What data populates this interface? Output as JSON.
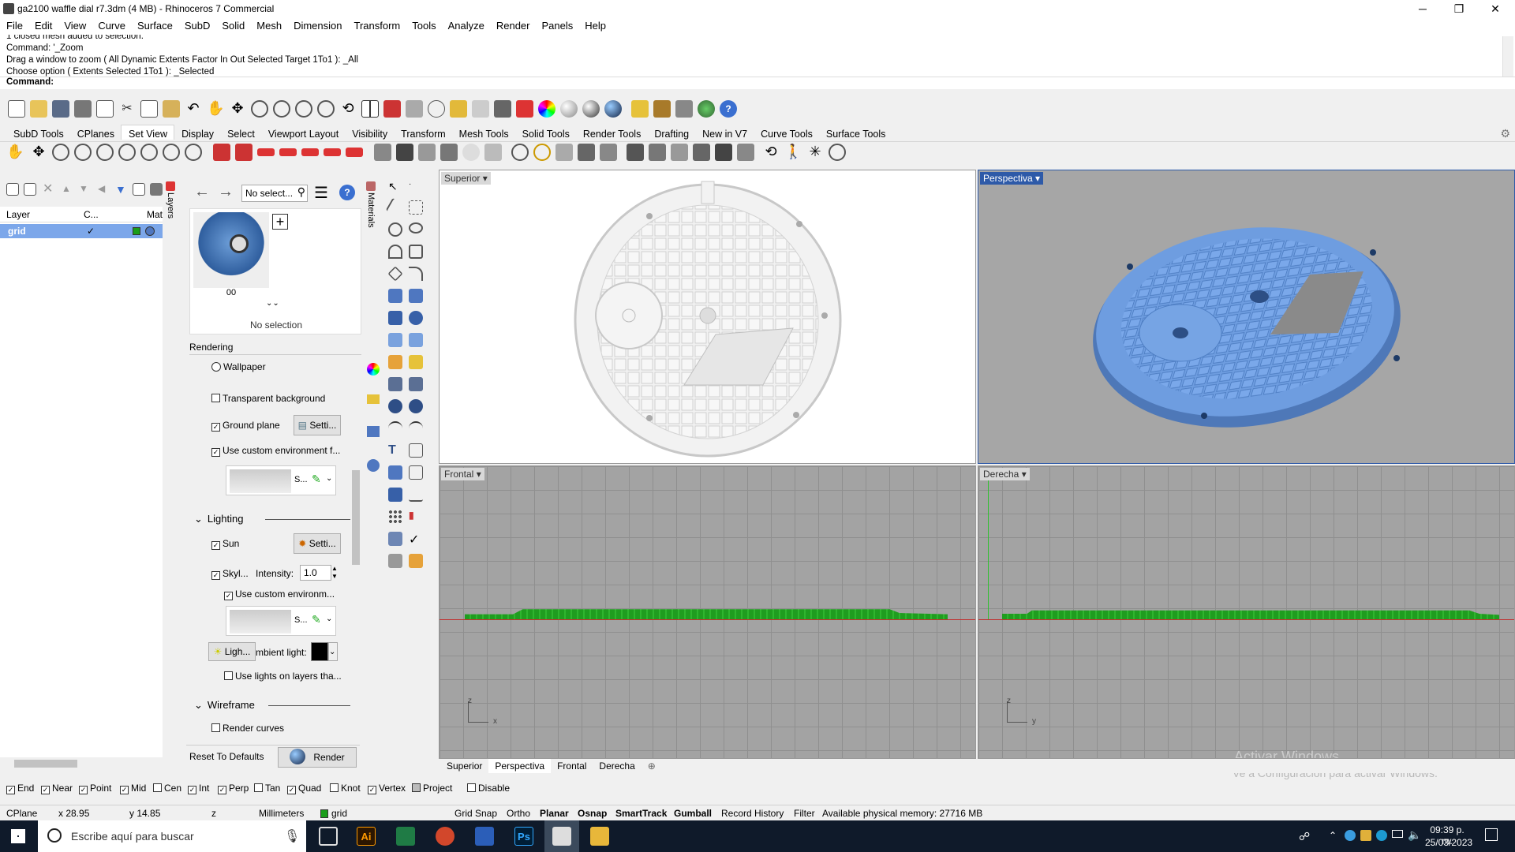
{
  "window": {
    "title": "ga2100 waffle dial r7.3dm (4 MB) - Rhinoceros 7 Commercial",
    "minimize": "─",
    "restore": "❐",
    "close": "✕"
  },
  "menu": [
    "File",
    "Edit",
    "View",
    "Curve",
    "Surface",
    "SubD",
    "Solid",
    "Mesh",
    "Dimension",
    "Transform",
    "Tools",
    "Analyze",
    "Render",
    "Panels",
    "Help"
  ],
  "history": [
    "1 closed mesh added to selection.",
    "Command: '_Zoom",
    "Drag a window to zoom ( All  Dynamic  Extents  Factor  In  Out  Selected  Target  1To1 ): _All",
    "Choose option ( Extents  Selected  1To1 ): _Selected"
  ],
  "command_prompt": "Command:",
  "toolbar_tabs": [
    "SubD Tools",
    "CPlanes",
    "Set View",
    "Display",
    "Select",
    "Viewport Layout",
    "Visibility",
    "Transform",
    "Mesh Tools",
    "Solid Tools",
    "Render Tools",
    "Drafting",
    "New in V7",
    "Curve Tools",
    "Surface Tools"
  ],
  "active_tab": "Set View",
  "layers": {
    "vertical_tab": "Layers",
    "col_layer": "Layer",
    "col_current": "C...",
    "col_material": "Mat",
    "rows": [
      {
        "name": "grid",
        "check": "✓"
      }
    ]
  },
  "materials": {
    "vertical_tab": "Materials",
    "search_placeholder": "No select...",
    "thumb_label": "00",
    "add_symbol": "+",
    "no_selection": "No selection"
  },
  "rendering": {
    "section": "Rendering",
    "wallpaper": "Wallpaper",
    "transparent_bg": "Transparent background",
    "ground_plane": "Ground plane",
    "settings_btn": "Setti...",
    "custom_env": "Use custom environment f...",
    "env_s": "S...",
    "lighting": "Lighting",
    "sun": "Sun",
    "skylight": "Skyl...",
    "intensity_label": "Intensity:",
    "intensity_value": "1.0",
    "use_custom_env2": "Use custom environm...",
    "lights_btn": "Ligh...",
    "ambient": "mbient light:",
    "use_lights_layers": "Use lights on layers tha...",
    "wireframe": "Wireframe",
    "render_curves": "Render curves",
    "reset_defaults": "Reset To Defaults",
    "render_btn": "Render"
  },
  "viewports": {
    "top": "Superior",
    "perspective": "Perspectiva",
    "front": "Frontal",
    "right": "Derecha",
    "axis_z": "z",
    "axis_x": "x",
    "axis_y": "y"
  },
  "viewport_tabs": [
    "Superior",
    "Perspectiva",
    "Frontal",
    "Derecha"
  ],
  "osnaps": [
    {
      "label": "End",
      "checked": true
    },
    {
      "label": "Near",
      "checked": true
    },
    {
      "label": "Point",
      "checked": true
    },
    {
      "label": "Mid",
      "checked": true
    },
    {
      "label": "Cen",
      "checked": false
    },
    {
      "label": "Int",
      "checked": true
    },
    {
      "label": "Perp",
      "checked": true
    },
    {
      "label": "Tan",
      "checked": false
    },
    {
      "label": "Quad",
      "checked": true
    },
    {
      "label": "Knot",
      "checked": false
    },
    {
      "label": "Vertex",
      "checked": true
    },
    {
      "label": "Project",
      "checked": false
    },
    {
      "label": "Disable",
      "checked": false
    }
  ],
  "status": {
    "cplane": "CPlane",
    "x": "x 28.95",
    "y": "y 14.85",
    "z": "z",
    "units": "Millimeters",
    "layer": "grid",
    "grid_snap": "Grid Snap",
    "ortho": "Ortho",
    "planar": "Planar",
    "osnap": "Osnap",
    "smarttrack": "SmartTrack",
    "gumball": "Gumball",
    "record_history": "Record History",
    "filter": "Filter",
    "memory": "Available physical memory: 27716 MB"
  },
  "watermark": {
    "line1": "Activar Windows",
    "line2": "Ve a Configuración para activar Windows."
  },
  "taskbar": {
    "search_placeholder": "Escribe aquí para buscar",
    "time": "09:39 p. m.",
    "date": "25/03/2023",
    "ai_label": "Ai",
    "ps_label": "Ps"
  },
  "colors": {
    "perspective_model": "#6e9de0",
    "viewport_highlight": "#2e5aa8",
    "front_model": "#1f9d1f",
    "x_axis": "#c03030",
    "y_axis": "#30c030"
  }
}
